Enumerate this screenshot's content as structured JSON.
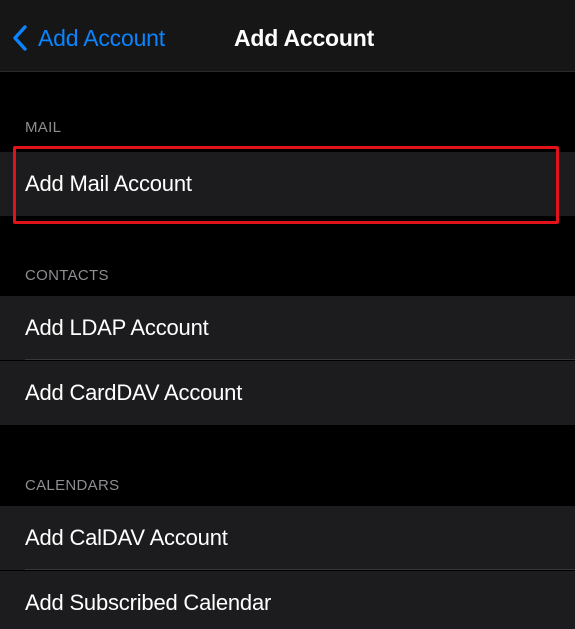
{
  "nav": {
    "back_label": "Add Account",
    "title": "Add Account",
    "back_icon": "chevron-left-icon"
  },
  "colors": {
    "accent": "#0a84ff",
    "background": "#000000",
    "cell": "#1c1c1e",
    "highlight": "#e0131c"
  },
  "sections": {
    "mail": {
      "header": "MAIL",
      "items": [
        "Add Mail Account"
      ]
    },
    "contacts": {
      "header": "CONTACTS",
      "items": [
        "Add LDAP Account",
        "Add CardDAV Account"
      ]
    },
    "calendars": {
      "header": "CALENDARS",
      "items": [
        "Add CalDAV Account",
        "Add Subscribed Calendar"
      ]
    }
  }
}
